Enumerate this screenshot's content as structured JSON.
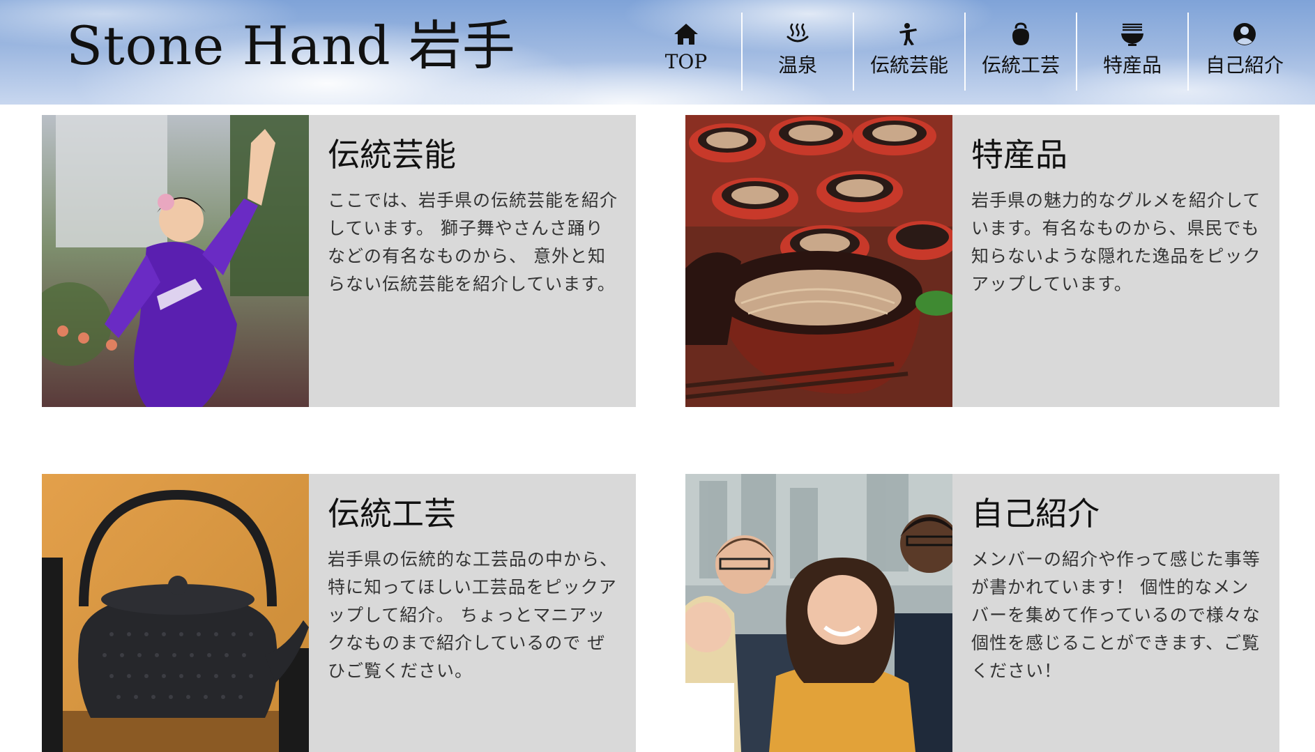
{
  "site": {
    "title": "Stone Hand 岩手"
  },
  "nav": {
    "items": [
      {
        "label": "TOP",
        "icon": "home-icon"
      },
      {
        "label": "温泉",
        "icon": "hot-spring-icon"
      },
      {
        "label": "伝統芸能",
        "icon": "dancer-icon"
      },
      {
        "label": "伝統工芸",
        "icon": "kettle-icon"
      },
      {
        "label": "特産品",
        "icon": "noodle-bowl-icon"
      },
      {
        "label": "自己紹介",
        "icon": "user-circle-icon"
      }
    ]
  },
  "cards": {
    "geino": {
      "title": "伝統芸能",
      "text": "ここでは、岩手県の伝統芸能を紹介しています。 獅子舞やさんさ踊りなどの有名なものから、 意外と知らない伝統芸能を紹介しています。",
      "image": "sansa-dancer-photo"
    },
    "tokusan": {
      "title": "特産品",
      "text": "岩手県の魅力的なグルメを紹介しています。有名なものから、県民でも知らないような隠れた逸品をピックアップしています。",
      "image": "wanko-soba-photo"
    },
    "kogei": {
      "title": "伝統工芸",
      "text": "岩手県の伝統的な工芸品の中から、特に知ってほしい工芸品をピックアップして紹介。 ちょっとマニアックなものまで紹介しているので ぜひご覧ください。",
      "image": "nambu-ironware-kettle-photo"
    },
    "jiko": {
      "title": "自己紹介",
      "text": "メンバーの紹介や作って感じた事等が書かれています！ 個性的なメンバーを集めて作っているので様々な個性を感じることができます、ご覧ください！",
      "image": "group-members-photo"
    }
  }
}
